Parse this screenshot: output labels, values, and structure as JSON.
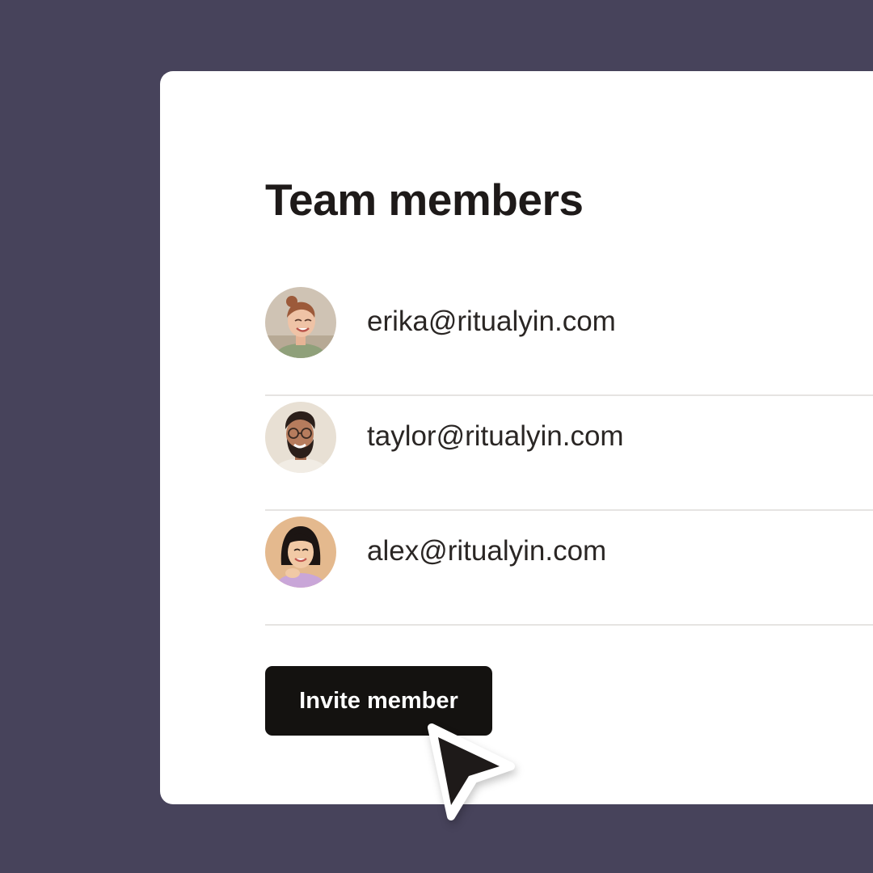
{
  "title": "Team members",
  "members": [
    {
      "email": "erika@ritualyin.com"
    },
    {
      "email": "taylor@ritualyin.com"
    },
    {
      "email": "alex@ritualyin.com"
    }
  ],
  "invite_button": {
    "label": "Invite member"
  },
  "colors": {
    "background": "#47435b",
    "card": "#ffffff",
    "button": "#141210",
    "text": "#1e1a19"
  }
}
